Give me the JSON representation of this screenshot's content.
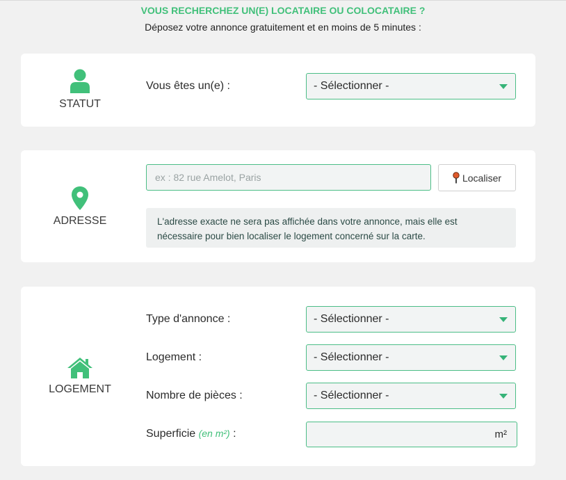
{
  "header": {
    "title": "VOUS RECHERCHEZ UN(E) LOCATAIRE OU COLOCATAIRE ?",
    "subtitle": "Déposez votre annonce gratuitement et en moins de 5 minutes :"
  },
  "colors": {
    "accent": "#41c07a",
    "field_border": "#4bbd86",
    "field_bg": "#f2f4f4"
  },
  "statut": {
    "section_label": "STATUT",
    "icon": "person-icon",
    "question": "Vous êtes un(e) :",
    "select_value": "- Sélectionner -"
  },
  "adresse": {
    "section_label": "ADRESSE",
    "icon": "location-pin-icon",
    "input_placeholder": "ex : 82 rue Amelot, Paris",
    "input_value": "",
    "locate_button": "Localiser",
    "note_line1": "L'adresse exacte ne sera pas affichée dans votre annonce, mais elle est",
    "note_line2": "nécessaire pour bien localiser le logement concerné sur la carte."
  },
  "logement": {
    "section_label": "LOGEMENT",
    "icon": "house-icon",
    "type_label": "Type d'annonce :",
    "type_value": "- Sélectionner -",
    "logement_label": "Logement :",
    "logement_value": "- Sélectionner -",
    "pieces_label": "Nombre de pièces :",
    "pieces_value": "- Sélectionner -",
    "superficie_label": "Superficie",
    "superficie_unit": "(en m²)",
    "superficie_colon": " :",
    "superficie_suffix": "m²"
  }
}
